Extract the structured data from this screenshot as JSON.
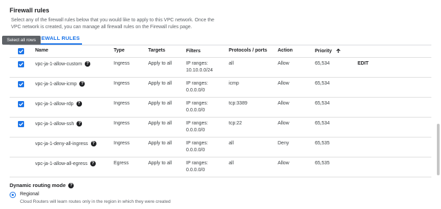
{
  "section": {
    "title": "Firewall rules",
    "description": "Select any of the firewall rules below that you would like to apply to this VPC network. Once the VPC network is created, you can manage all firewall rules on the Firewall rules page."
  },
  "tab": {
    "label": "EWALL RULES"
  },
  "tooltip": {
    "text": "Select all rows"
  },
  "table": {
    "headers": {
      "name": "Name",
      "type": "Type",
      "targets": "Targets",
      "filters": "Filters",
      "protocols": "Protocols / ports",
      "action": "Action",
      "priority": "Priority"
    },
    "rows": [
      {
        "checked": true,
        "name": "vpc-ja-1-allow-custom",
        "type": "Ingress",
        "targets": "Apply to all",
        "filters_label": "IP ranges:",
        "filters_value": "10.10.0.0/24",
        "protocols": "all",
        "action": "Allow",
        "priority": "65,534",
        "edit": "EDIT"
      },
      {
        "checked": true,
        "name": "vpc-ja-1-allow-icmp",
        "type": "Ingress",
        "targets": "Apply to all",
        "filters_label": "IP ranges:",
        "filters_value": "0.0.0.0/0",
        "protocols": "icmp",
        "action": "Allow",
        "priority": "65,534"
      },
      {
        "checked": true,
        "name": "vpc-ja-1-allow-rdp",
        "type": "Ingress",
        "targets": "Apply to all",
        "filters_label": "IP ranges:",
        "filters_value": "0.0.0.0/0",
        "protocols": "tcp:3389",
        "action": "Allow",
        "priority": "65,534"
      },
      {
        "checked": true,
        "name": "vpc-ja-1-allow-ssh",
        "type": "Ingress",
        "targets": "Apply to all",
        "filters_label": "IP ranges:",
        "filters_value": "0.0.0.0/0",
        "protocols": "tcp:22",
        "action": "Allow",
        "priority": "65,534"
      },
      {
        "checked": false,
        "name": "vpc-ja-1-deny-all-ingress",
        "type": "Ingress",
        "targets": "Apply to all",
        "filters_label": "IP ranges:",
        "filters_value": "0.0.0.0/0",
        "protocols": "all",
        "action": "Deny",
        "priority": "65,535"
      },
      {
        "checked": false,
        "name": "vpc-ja-1-allow-all-egress",
        "type": "Egress",
        "targets": "Apply to all",
        "filters_label": "IP ranges:",
        "filters_value": "0.0.0.0/0",
        "protocols": "all",
        "action": "Allow",
        "priority": "65,535"
      }
    ]
  },
  "routing": {
    "title": "Dynamic routing mode",
    "option_label": "Regional",
    "option_desc": "Cloud Routers will learn routes only in the region in which they were created"
  },
  "colors": {
    "accent": "#1a73e8",
    "tooltip_bg": "#5f6368",
    "border": "#e0e0e0"
  },
  "icons": {
    "help": "help-circle-icon",
    "sort": "arrow-upward-icon",
    "check": "check-icon"
  }
}
